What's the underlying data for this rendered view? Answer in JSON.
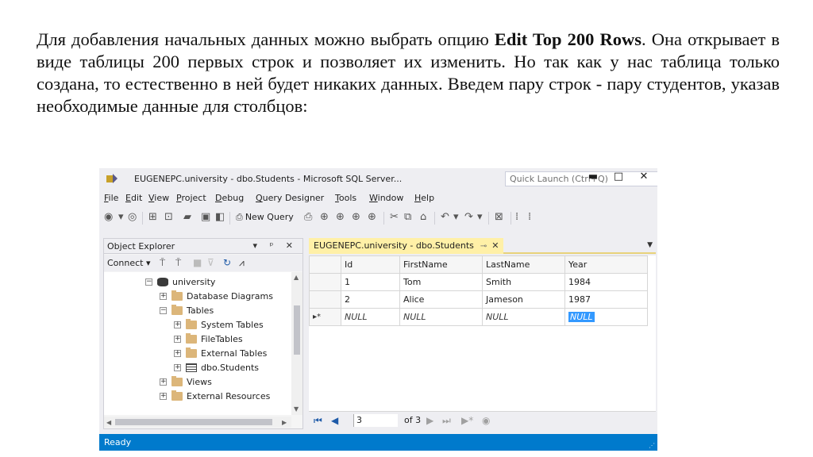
{
  "paragraph": {
    "part1": "Для добавления начальных данных можно выбрать опцию ",
    "bold": "Edit Top 200 Rows",
    "part2": ". Она открывает в виде таблицы 200 первых строк и позволяет их изменить. Но так как у нас таблица только создана, то естественно в ней будет никаких данных. Введем пару строк - пару студентов, указав необходимые данные для столбцов:"
  },
  "window": {
    "title": "EUGENEPC.university - dbo.Students - Microsoft SQL Server...",
    "quick_launch_placeholder": "Quick Launch (Ctrl+Q)",
    "minimize_glyph": "▬",
    "maximize_glyph": "□",
    "close_glyph": "✕"
  },
  "menu": {
    "file": "File",
    "edit": "Edit",
    "view": "View",
    "project": "Project",
    "debug": "Debug",
    "query_designer": "Query Designer",
    "tools": "Tools",
    "window": "Window",
    "help": "Help"
  },
  "toolbar": {
    "new_query": "New Query"
  },
  "object_explorer": {
    "title": "Object Explorer",
    "pin_glyph": "▾ ᵖ ✕",
    "connect": "Connect",
    "tree": {
      "university": "university",
      "database_diagrams": "Database Diagrams",
      "tables": "Tables",
      "system_tables": "System Tables",
      "file_tables": "FileTables",
      "external_tables": "External Tables",
      "students": "dbo.Students",
      "views": "Views",
      "external_resources": "External Resources"
    },
    "expand_plus": "+",
    "expand_minus": "−"
  },
  "document": {
    "tab_label": "EUGENEPC.university - dbo.Students",
    "tab_pin": "⊸",
    "tab_close": "✕",
    "tab_menu": "▼",
    "columns": [
      "Id",
      "FirstName",
      "LastName",
      "Year"
    ],
    "rows": [
      {
        "marker": "",
        "id": "1",
        "first": "Tom",
        "last": "Smith",
        "year": "1984"
      },
      {
        "marker": "",
        "id": "2",
        "first": "Alice",
        "last": "Jameson",
        "year": "1987"
      },
      {
        "marker": "▸*",
        "id": "NULL",
        "first": "NULL",
        "last": "NULL",
        "year": "NULL"
      }
    ],
    "pager": {
      "current": "3",
      "of_text": "of 3"
    }
  },
  "status": {
    "text": "Ready"
  },
  "colors": {
    "status_bar": "#007acc",
    "tab_active": "#fff0a7",
    "selection": "#3399ff"
  }
}
